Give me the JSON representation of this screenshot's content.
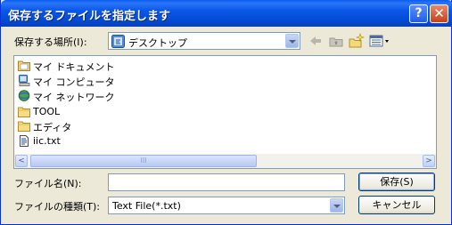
{
  "window": {
    "title": "保存するファイルを指定します",
    "help_label": "?",
    "close_label": "✕"
  },
  "location": {
    "label": "保存する場所(I):",
    "value": "デスクトップ"
  },
  "files": [
    {
      "name": "マイ ドキュメント",
      "icon": "my-documents-icon"
    },
    {
      "name": "マイ コンピュータ",
      "icon": "my-computer-icon"
    },
    {
      "name": "マイ ネットワーク",
      "icon": "my-network-icon"
    },
    {
      "name": "TOOL",
      "icon": "folder-icon"
    },
    {
      "name": "エディタ",
      "icon": "folder-icon"
    },
    {
      "name": "iic.txt",
      "icon": "text-file-icon"
    }
  ],
  "filename": {
    "label": "ファイル名(N):",
    "value": ""
  },
  "filetype": {
    "label": "ファイルの種類(T):",
    "value": "Text File(*.txt)"
  },
  "buttons": {
    "save": "保存(S)",
    "cancel": "キャンセル"
  },
  "scroll": {
    "left": "<",
    "right": ">",
    "grip": "III"
  }
}
